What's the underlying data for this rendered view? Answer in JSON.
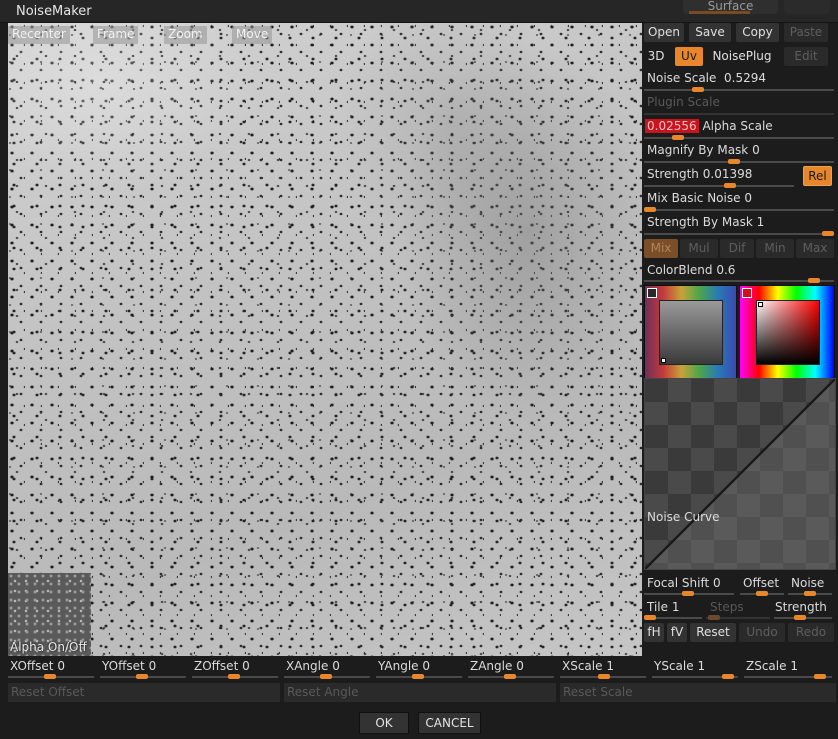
{
  "window": {
    "title": "NoiseMaker",
    "tab_label": "Surface"
  },
  "preview": {
    "buttons": {
      "recenter": "Recenter",
      "frame": "Frame",
      "zoom": "Zoom",
      "move": "Move"
    },
    "alpha_toggle": "Alpha On/Off"
  },
  "panel": {
    "row1": {
      "open": "Open",
      "save": "Save",
      "copy": "Copy",
      "paste": "Paste"
    },
    "row2": {
      "mode3d": "3D",
      "uv": "Uv",
      "noiseplug": "NoisePlug",
      "edit": "Edit"
    },
    "noise_scale": {
      "label": "Noise Scale",
      "value": "0.5294",
      "fraction": 0.27
    },
    "plugin_scale": {
      "label": "Plugin Scale"
    },
    "alpha_scale": {
      "label": "Alpha Scale",
      "value": "0.02556",
      "fraction": 0.16
    },
    "magnify_by_mask": {
      "label": "Magnify By Mask",
      "value": "0",
      "fraction": 0.47
    },
    "strength": {
      "label": "Strength",
      "value": "0.01398",
      "fraction": 0.58,
      "rel": "Rel"
    },
    "mix_basic_noise": {
      "label": "Mix Basic Noise",
      "value": "0",
      "fraction": 0.0
    },
    "strength_by_mask": {
      "label": "Strength By Mask",
      "value": "1",
      "fraction": 1.0
    },
    "blend_modes": [
      "Mix",
      "Mul",
      "Dif",
      "Min",
      "Max"
    ],
    "color_blend": {
      "label": "ColorBlend",
      "value": "0.6",
      "fraction": 0.92
    },
    "noise_curve": "Noise Curve",
    "focal_shift": {
      "label": "Focal Shift",
      "value": "0"
    },
    "offset": "Offset",
    "noise": "Noise",
    "tile": {
      "label": "Tile",
      "value": "1"
    },
    "steps": "Steps",
    "strength2": "Strength",
    "actions": {
      "fh": "fH",
      "fv": "fV",
      "reset": "Reset",
      "undo": "Undo",
      "redo": "Redo"
    }
  },
  "bottom": {
    "sliders": [
      {
        "label": "XOffset",
        "value": "0"
      },
      {
        "label": "YOffset",
        "value": "0"
      },
      {
        "label": "ZOffset",
        "value": "0"
      },
      {
        "label": "XAngle",
        "value": "0"
      },
      {
        "label": "YAngle",
        "value": "0"
      },
      {
        "label": "ZAngle",
        "value": "0"
      },
      {
        "label": "XScale",
        "value": "1"
      },
      {
        "label": "YScale",
        "value": "1"
      },
      {
        "label": "ZScale",
        "value": "1"
      }
    ],
    "reset_offset": "Reset Offset",
    "reset_angle": "Reset Angle",
    "reset_scale": "Reset Scale",
    "ok": "OK",
    "cancel": "CANCEL"
  },
  "colors": {
    "accent": "#e8862b",
    "alpha_scale_highlight": "#c8141e"
  }
}
